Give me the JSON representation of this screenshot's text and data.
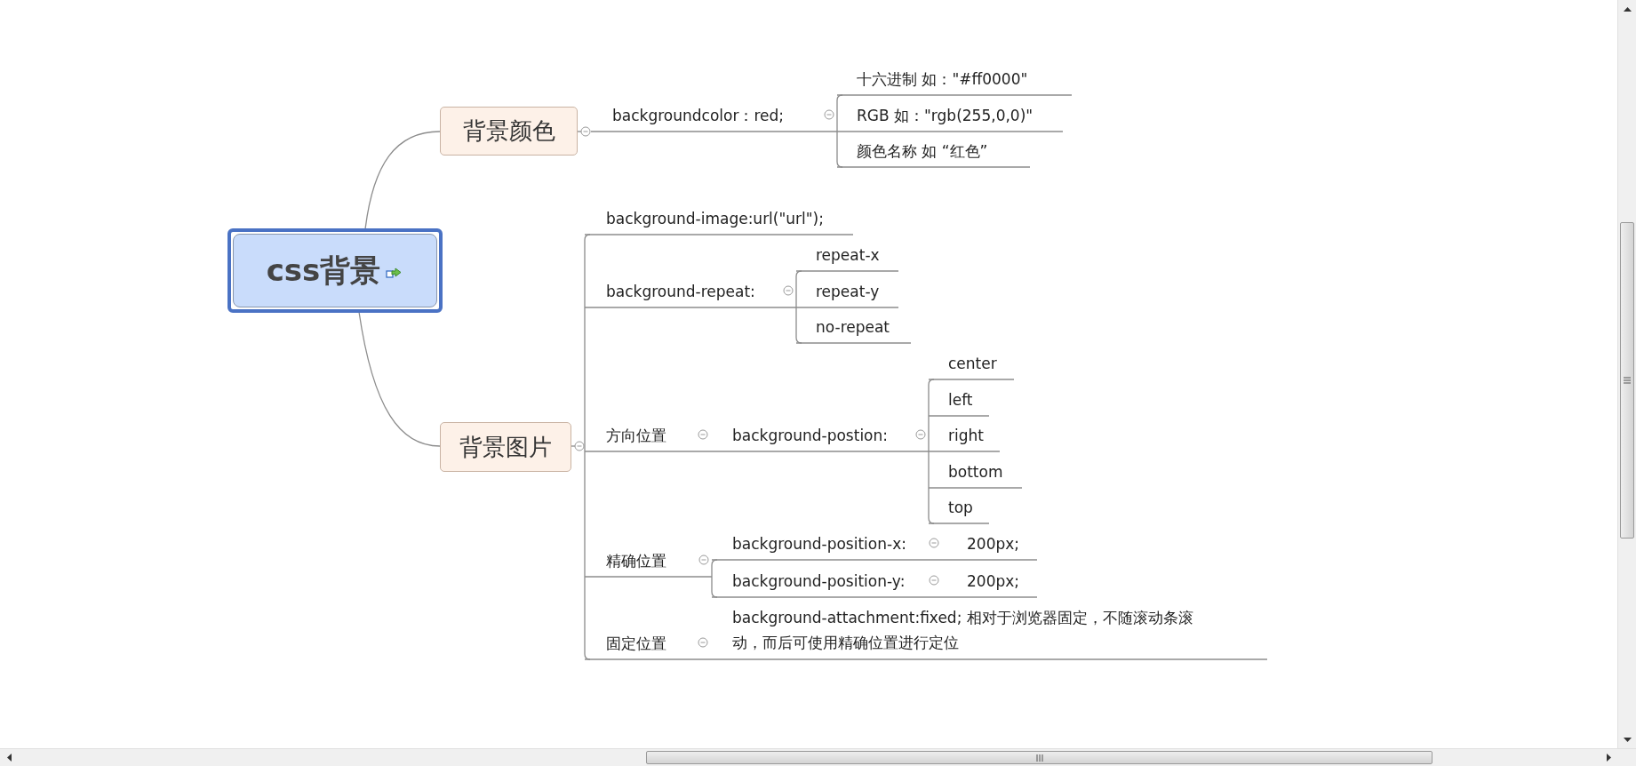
{
  "map": {
    "root": {
      "title": "css背景",
      "children": [
        {
          "title": "背景颜色",
          "children": [
            {
              "title": "backgroundcolor：red;",
              "children": [
                {
                  "title": "十六进制 如：\"#ff0000\""
                },
                {
                  "title": "RGB 如：\"rgb(255,0,0)\""
                },
                {
                  "title": "颜色名称 如 “红色”"
                }
              ]
            }
          ]
        },
        {
          "title": "背景图片",
          "children": [
            {
              "title": "background-image:url(\"url\");"
            },
            {
              "title": "background-repeat:",
              "children": [
                {
                  "title": "repeat-x"
                },
                {
                  "title": "repeat-y"
                },
                {
                  "title": "no-repeat"
                }
              ]
            },
            {
              "title": "方向位置",
              "children": [
                {
                  "title": "background-postion:",
                  "children": [
                    {
                      "title": "center"
                    },
                    {
                      "title": "left"
                    },
                    {
                      "title": "right"
                    },
                    {
                      "title": "bottom"
                    },
                    {
                      "title": "top"
                    }
                  ]
                }
              ]
            },
            {
              "title": "精确位置",
              "children": [
                {
                  "title": "background-position-x:",
                  "children": [
                    {
                      "title": "200px;"
                    }
                  ]
                },
                {
                  "title": "background-position-y:",
                  "children": [
                    {
                      "title": "200px;"
                    }
                  ]
                }
              ]
            },
            {
              "title": "固定位置",
              "children": [
                {
                  "title": "background-attachment:fixed; 相对于浏览器固定，不随滚动条滚动，而后可使用精确位置进行定位"
                }
              ]
            }
          ]
        }
      ]
    }
  }
}
